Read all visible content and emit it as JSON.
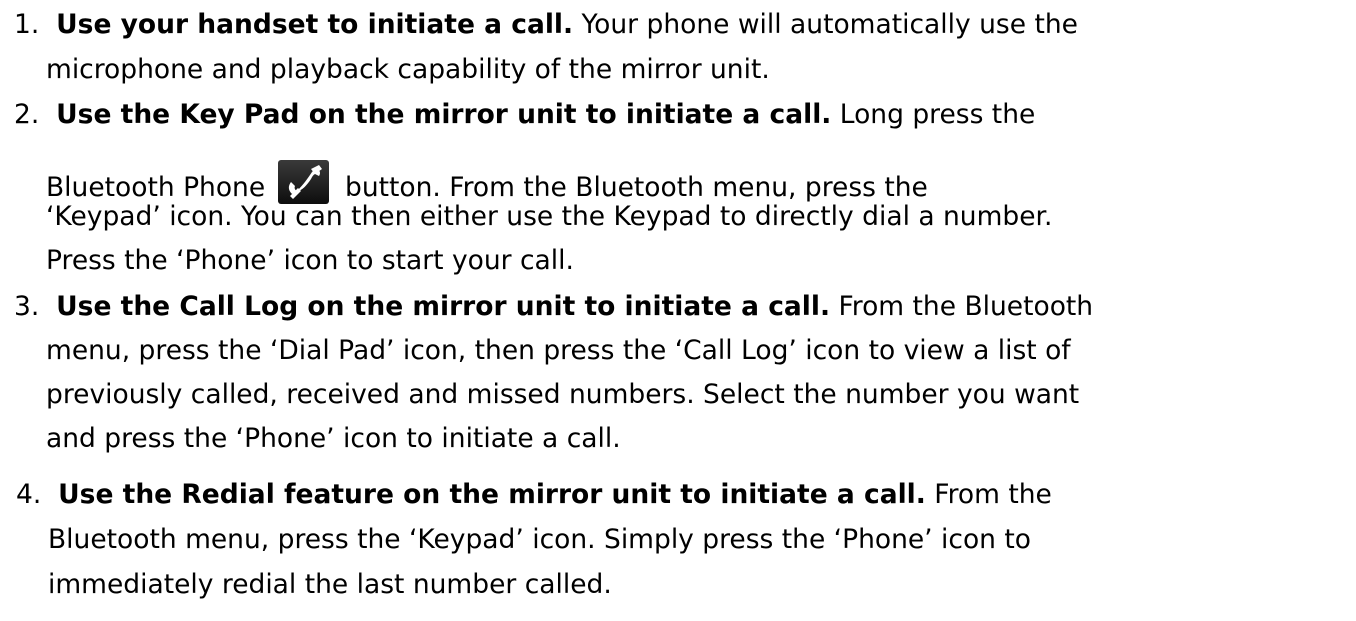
{
  "items": [
    {
      "number": "1.",
      "bold": "Use your handset to initiate a call.",
      "text1": " Your phone will automatically use the",
      "text2": "microphone and playback capability of the mirror unit."
    },
    {
      "number": "2.",
      "bold": "Use the Key Pad on the mirror unit to initiate a call.",
      "text1": " Long press the",
      "text2a": "Bluetooth Phone",
      "text2b": "button. From the Bluetooth menu, press the",
      "text3": "‘Keypad’ icon. You can then either use the Keypad to directly dial a number.",
      "text4": "Press the ‘Phone’ icon to start your call."
    },
    {
      "number": "3.",
      "bold": "Use the Call Log on the mirror unit to initiate a call.",
      "text1": " From the Bluetooth",
      "text2": "menu, press the ‘Dial Pad’ icon, then press the ‘Call Log’ icon to view a list of",
      "text3": "previously called, received and missed numbers. Select the number you want",
      "text4": "and press the ‘Phone’ icon to initiate a call."
    },
    {
      "number": "4.",
      "bold": "Use the Redial feature on the mirror unit to initiate a call.",
      "text1": " From the",
      "text2": "Bluetooth menu, press the ‘Keypad’ icon. Simply press the ‘Phone’ icon to",
      "text3": "immediately redial the last number called."
    }
  ],
  "icons": {
    "phone_button": "phone-handset-icon"
  },
  "colors": {
    "text": "#000000",
    "icon_background": "#1a1a1a",
    "icon_glyph": "#ffffff"
  }
}
